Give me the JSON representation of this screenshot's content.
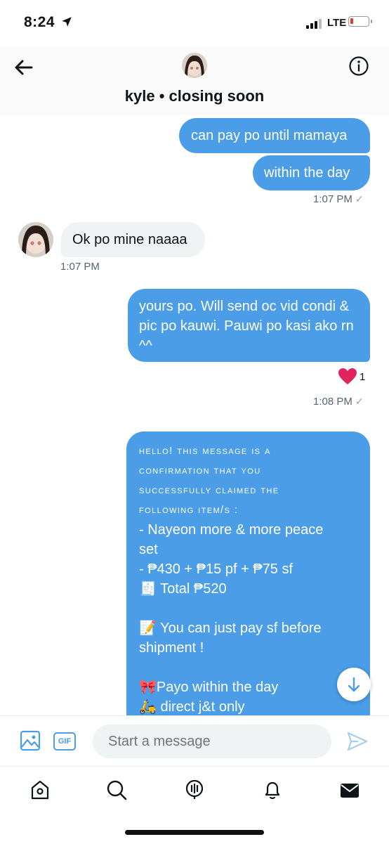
{
  "status_bar": {
    "time": "8:24",
    "network": "LTE",
    "battery_level_percent": 10
  },
  "header": {
    "title": "kyle • closing soon"
  },
  "messages": {
    "m1": "can pay po until mamaya",
    "m2": "within the day",
    "m2_time": "1:07 PM",
    "m3": "Ok po mine naaaa",
    "m3_time": "1:07 PM",
    "m4": "yours po. Will send oc vid condi & pic po kauwi. Pauwi po kasi ako rn ^^",
    "m4_reaction": "❤️",
    "m4_reaction_count": "1",
    "m4_time": "1:08 PM",
    "m5": {
      "caps_lines": [
        "Hello! this message is a",
        "confirmation that you",
        "successfully claimed the",
        "following item/s :"
      ],
      "item_lines": [
        "- Nayeon more & more peace",
        "set",
        "- ₱430 + ₱15 pf + ₱75 sf",
        "🧾 Total ₱520",
        "📝 You can just pay sf before",
        "shipment !",
        "🎀Payo within the day",
        "🛵 direct j&t only"
      ]
    },
    "read_check": "✓"
  },
  "composer": {
    "placeholder": "Start a message",
    "gif_label": "GIF"
  },
  "colors": {
    "sent_bubble": "#4a9de6",
    "received_bubble": "#eff3f4",
    "accent": "#4a9de6"
  },
  "icons": [
    "back-arrow-icon",
    "info-icon",
    "image-icon",
    "gif-icon",
    "send-icon",
    "home-icon",
    "search-icon",
    "spaces-icon",
    "notifications-icon",
    "messages-icon",
    "arrow-down-icon"
  ]
}
